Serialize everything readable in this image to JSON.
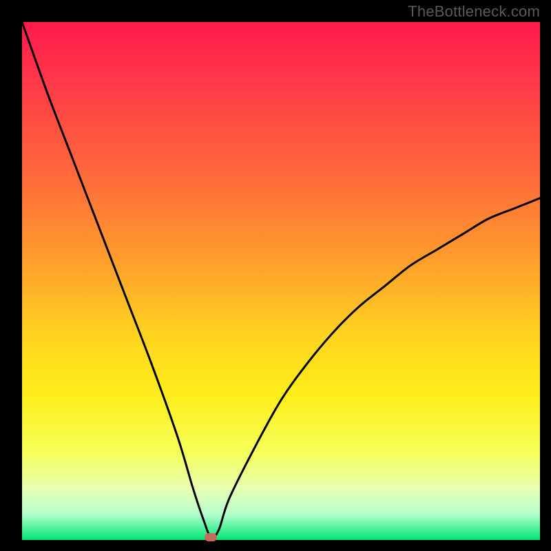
{
  "watermark": "TheBottleneck.com",
  "chart_data": {
    "type": "line",
    "title": "",
    "xlabel": "",
    "ylabel": "",
    "xlim": [
      0,
      100
    ],
    "ylim": [
      0,
      100
    ],
    "background_gradient": {
      "stops": [
        {
          "y": 0,
          "color": "#ff1a4c"
        },
        {
          "y": 12,
          "color": "#ff3a48"
        },
        {
          "y": 30,
          "color": "#ff6b3a"
        },
        {
          "y": 45,
          "color": "#ff9a2d"
        },
        {
          "y": 60,
          "color": "#ffd21f"
        },
        {
          "y": 72,
          "color": "#ffee1a"
        },
        {
          "y": 83,
          "color": "#f6ff5a"
        },
        {
          "y": 90,
          "color": "#e8ffb0"
        },
        {
          "y": 95,
          "color": "#b7ffce"
        },
        {
          "y": 100,
          "color": "#00e676"
        }
      ]
    },
    "series": [
      {
        "name": "bottleneck-curve",
        "x": [
          0,
          5,
          10,
          15,
          20,
          25,
          30,
          33,
          35,
          36.5,
          38,
          40,
          45,
          50,
          55,
          60,
          65,
          70,
          75,
          80,
          85,
          90,
          95,
          100
        ],
        "y": [
          100,
          86,
          73,
          60,
          47,
          34,
          20,
          10,
          4,
          0.5,
          2,
          8,
          18,
          27,
          34,
          40,
          45,
          49,
          53,
          56,
          59,
          62,
          64,
          66
        ]
      }
    ],
    "marker": {
      "x": 36.5,
      "y": 0.5,
      "color": "#c76a5a"
    }
  }
}
